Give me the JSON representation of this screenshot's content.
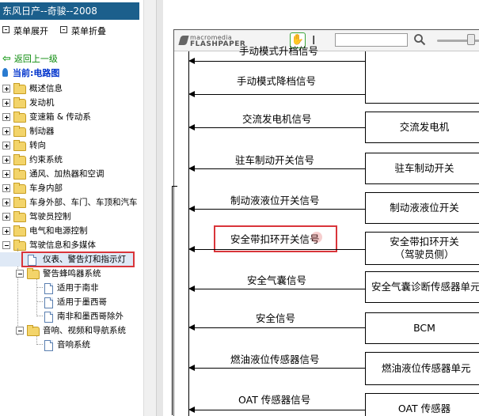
{
  "left_panel": {
    "title": "东风日产--奇骏--2008",
    "expand_label": "菜单展开",
    "collapse_label": "菜单折叠",
    "back_label": "返回上一级",
    "current_label": "当前:电路图",
    "tree": [
      {
        "label": "概述信息",
        "expanded": false
      },
      {
        "label": "发动机",
        "expanded": false
      },
      {
        "label": "变速箱 & 传动系",
        "expanded": false
      },
      {
        "label": "制动器",
        "expanded": false
      },
      {
        "label": "转向",
        "expanded": false
      },
      {
        "label": "约束系统",
        "expanded": false
      },
      {
        "label": "通风、加热器和空调",
        "expanded": false
      },
      {
        "label": "车身内部",
        "expanded": false
      },
      {
        "label": "车身外部、车门、车顶和汽车",
        "expanded": false
      },
      {
        "label": "驾驶员控制",
        "expanded": false
      },
      {
        "label": "电气和电源控制",
        "expanded": false
      },
      {
        "label": "驾驶信息和多媒体",
        "expanded": true
      }
    ],
    "sub_tree": {
      "selected_doc": "仪表、警告灯和指示灯",
      "warning_system": "警告蜂鸣器系统",
      "warning_children": [
        "适用于南非",
        "适用于墨西哥",
        "南非和墨西哥除外"
      ],
      "av_system": "音响、视频和导航系统",
      "av_children": [
        "音响系统"
      ]
    }
  },
  "viewer": {
    "logo_top": "macromedia",
    "logo_bottom": "FLASHPAPER",
    "hand_icon": "hand-icon",
    "text_tool_glyph": "I",
    "search_value": "",
    "signals": [
      {
        "label": "手动模式升档信号",
        "component": ""
      },
      {
        "label": "手动模式降档信号",
        "component": ""
      },
      {
        "label": "交流发电机信号",
        "component": "交流发电机"
      },
      {
        "label": "驻车制动开关信号",
        "component": "驻车制动开关"
      },
      {
        "label": "制动液液位开关信号",
        "component": "制动液液位开关"
      },
      {
        "label": "安全带扣环开关信号",
        "component": "安全带扣环开关",
        "component_sub": "（驾驶员侧）"
      },
      {
        "label": "安全气囊信号",
        "component": "安全气囊诊断传感器单元"
      },
      {
        "label": "安全信号",
        "component": "BCM"
      },
      {
        "label": "燃油液位传感器信号",
        "component": "燃油液位传感器单元"
      },
      {
        "label": "OAT 传感器信号",
        "component": "OAT 传感器"
      }
    ]
  },
  "colors": {
    "title_bar": "#1b5f8c",
    "highlight": "#d9353a",
    "back_link": "#0a8a0a",
    "current_link": "#0033cc"
  }
}
